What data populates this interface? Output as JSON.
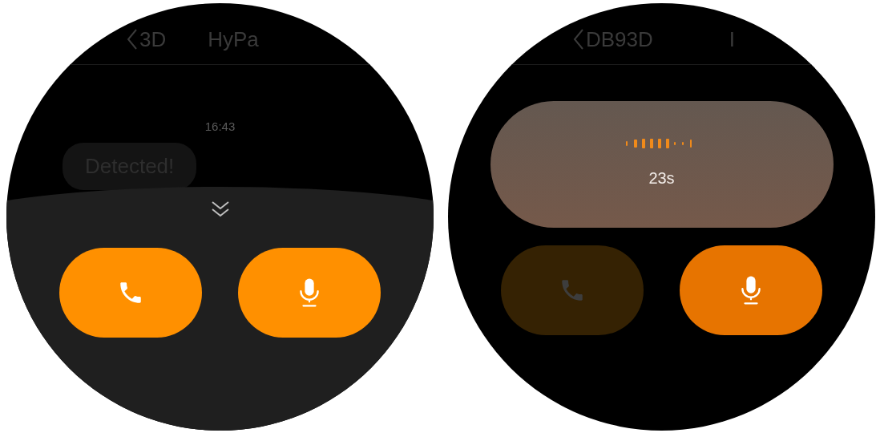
{
  "screens": [
    {
      "header": {
        "back_label": "3D",
        "title": "HyPa"
      },
      "time": "16:43",
      "message": "Detected!",
      "sheet": {
        "expanded": true
      },
      "buttons": [
        {
          "kind": "call",
          "disabled": false
        },
        {
          "kind": "mic",
          "disabled": false,
          "pressed": false
        }
      ]
    },
    {
      "header": {
        "back_label": "DB93D",
        "title": "I"
      },
      "recording": {
        "duration": "23s"
      },
      "buttons": [
        {
          "kind": "call",
          "disabled": true
        },
        {
          "kind": "mic",
          "disabled": false,
          "pressed": true
        }
      ]
    }
  ]
}
